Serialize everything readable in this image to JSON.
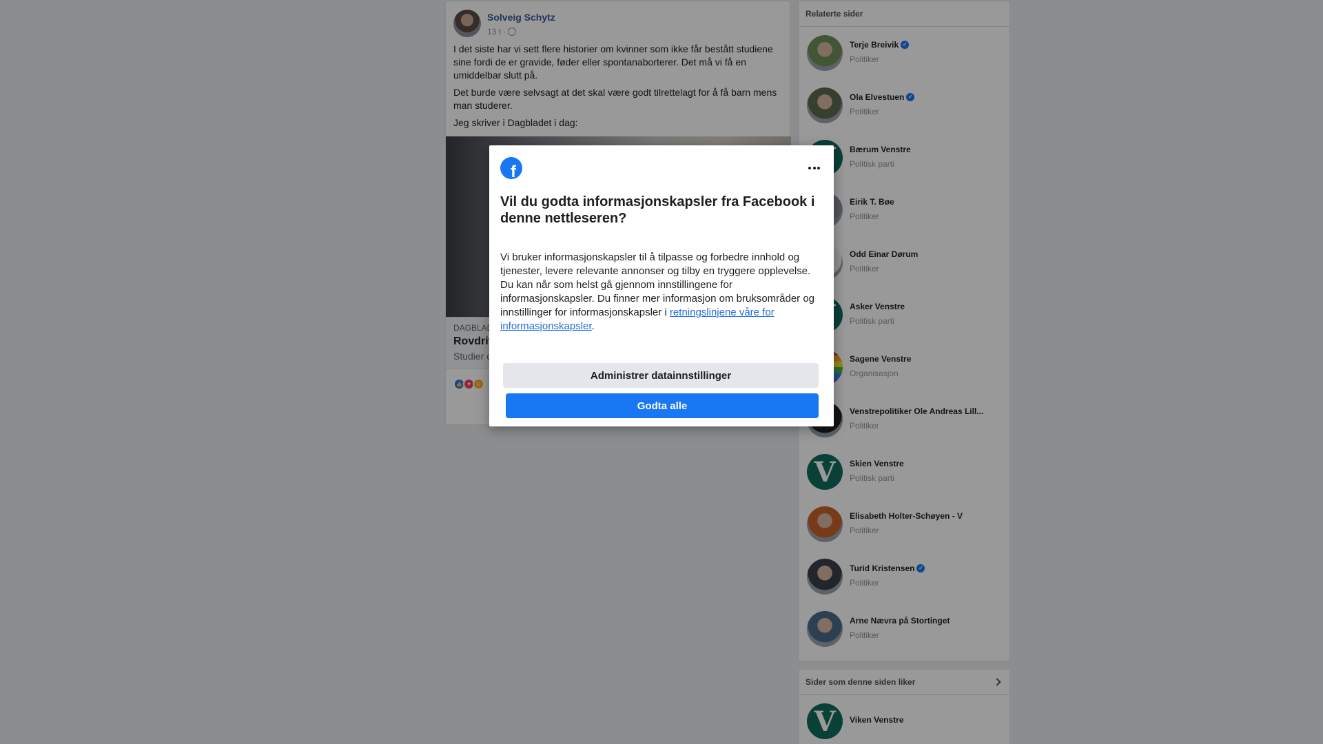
{
  "post": {
    "author": "Solveig Schytz",
    "time": "13 t ·",
    "paragraphs": [
      "I det siste har vi sett flere historier om kvinner som ikke får bestått studiene sine fordi de er gravide, føder eller spontanaborterer. Det må vi få en umiddelbar slutt på.",
      "Det burde være selvsagt at det skal være godt tilrettelagt for å få barn mens man studerer.",
      "Jeg skriver i Dagbladet i dag:"
    ],
    "link_domain": "DAGBLAD",
    "link_title": "Rovdrit",
    "link_desc": "Studier o"
  },
  "sidebar": {
    "related_title": "Relaterte sider",
    "items": [
      {
        "name": "Terje Breivik",
        "category": "Politiker",
        "verified": true,
        "thumb": "photo",
        "color": "#6f8f5b"
      },
      {
        "name": "Ola Elvestuen",
        "category": "Politiker",
        "verified": true,
        "thumb": "photo",
        "color": "#5d6b4f"
      },
      {
        "name": "Bærum Venstre",
        "category": "Politisk parti",
        "verified": false,
        "thumb": "logo",
        "color": "#0f6d5f"
      },
      {
        "name": "Eirik T. Bøe",
        "category": "Politiker",
        "verified": false,
        "thumb": "photo",
        "color": "#8a8f99"
      },
      {
        "name": "Odd Einar Dørum",
        "category": "Politiker",
        "verified": false,
        "thumb": "photo",
        "color": "#f0f0f0"
      },
      {
        "name": "Asker Venstre",
        "category": "Politisk parti",
        "verified": false,
        "thumb": "logo",
        "color": "#0f6d5f"
      },
      {
        "name": "Sagene Venstre",
        "category": "Organisasjon",
        "verified": false,
        "thumb": "rainbow",
        "color": "#e63b2e"
      },
      {
        "name": "Venstrepolitiker Ole Andreas Lill...",
        "category": "Politiker",
        "verified": false,
        "thumb": "photo",
        "color": "#222222"
      },
      {
        "name": "Skien Venstre",
        "category": "Politisk parti",
        "verified": false,
        "thumb": "logo",
        "color": "#0f6d5f"
      },
      {
        "name": "Elisabeth Holter-Schøyen - V",
        "category": "Politiker",
        "verified": false,
        "thumb": "photo",
        "color": "#c9632c"
      },
      {
        "name": "Turid Kristensen",
        "category": "Politiker",
        "verified": true,
        "thumb": "photo",
        "color": "#3b3f4a"
      },
      {
        "name": "Arne Nævra på Stortinget",
        "category": "Politiker",
        "verified": false,
        "thumb": "photo",
        "color": "#4c6a8a"
      }
    ],
    "liked_title": "Sider som denne siden liker",
    "liked_items": [
      {
        "name": "Viken Venstre",
        "thumb": "logo",
        "color": "#0f6d5f"
      }
    ]
  },
  "dialog": {
    "logo_letter": "f",
    "title": "Vil du godta informasjonskapsler fra Facebook i denne nettleseren?",
    "body": "Vi bruker informasjonskapsler til å tilpasse og forbedre innhold og tjenester, levere relevante annonser og tilby en tryggere opplevelse. Du kan når som helst gå gjennom innstillingene for informasjonskapsler. Du finner mer informasjon om bruksområder og innstillinger for informasjonskapsler i ",
    "link_text": "retningslinjene våre for informasjonskapsler",
    "body_end": ".",
    "manage_label": "Administrer datainnstillinger",
    "accept_label": "Godta alle"
  }
}
